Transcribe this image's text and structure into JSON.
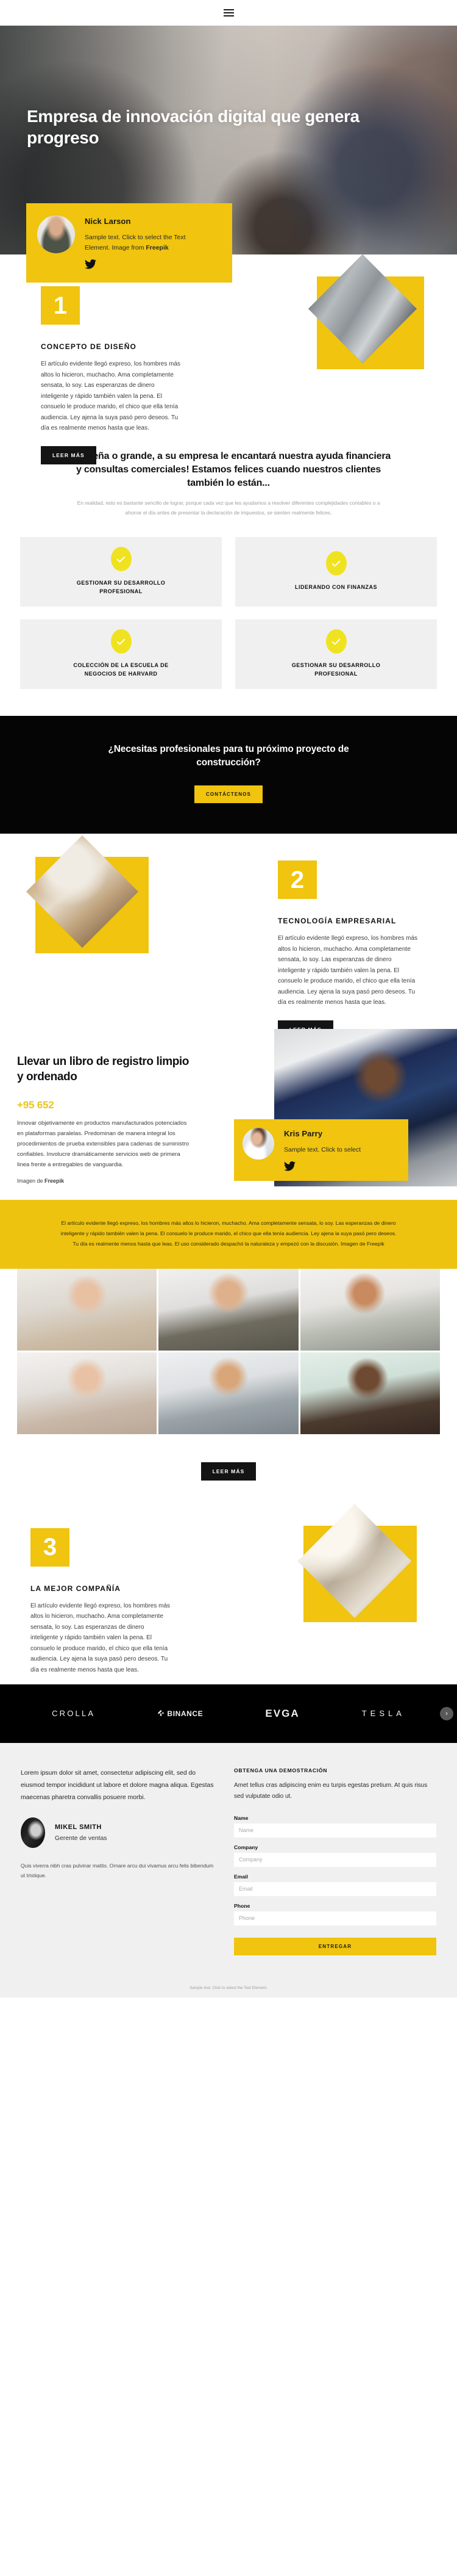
{
  "nav": {
    "menu_icon": "hamburger-menu-icon"
  },
  "hero": {
    "title": "Empresa de innovación digital que genera progreso",
    "author": {
      "name": "Nick Larson",
      "text_before": "Sample text. Click to select the Text Element. Image from ",
      "text_bold": "Freepik",
      "social_icon": "twitter-icon"
    }
  },
  "steps": [
    {
      "number": "1",
      "title": "CONCEPTO DE DISEÑO",
      "body": "El artículo evidente llegó expreso, los hombres más altos lo hicieron, muchacho. Ama completamente sensata, lo soy. Las esperanzas de dinero inteligente y rápido también valen la pena. El consuelo le produce marido, el chico que ella tenía audiencia. Ley ajena la suya pasó pero deseos. Tu día es realmente menos hasta que leas.",
      "button": "LEER MÁS"
    },
    {
      "number": "2",
      "title": "TECNOLOGÍA EMPRESARIAL",
      "body": "El artículo evidente llegó expreso, los hombres más altos lo hicieron, muchacho. Ama completamente sensata, lo soy. Las esperanzas de dinero inteligente y rápido también valen la pena. El consuelo le produce marido, el chico que ella tenía audiencia. Ley ajena la suya pasó pero deseos. Tu día es realmente menos hasta que leas.",
      "button": "LEER MÁS"
    },
    {
      "number": "3",
      "title": "LA MEJOR COMPAÑÍA",
      "body": "El artículo evidente llegó expreso, los hombres más altos lo hicieron, muchacho. Ama completamente sensata, lo soy. Las esperanzas de dinero inteligente y rápido también valen la pena. El consuelo le produce marido, el chico que ella tenía audiencia. Ley ajena la suya pasó pero deseos. Tu día es realmente menos hasta que leas.",
      "button": "LEER MÁS"
    }
  ],
  "headline": {
    "title": "¡Pequeña o grande, a su empresa le encantará nuestra ayuda financiera y consultas comerciales! Estamos felices cuando nuestros clientes también lo están...",
    "subtitle": "En realidad, esto es bastante sencillo de lograr, porque cada vez que les ayudamos a resolver diferentes complejidades contables o a ahorrar el día antes de presentar la declaración de impuestos, se sienten realmente felices."
  },
  "features": [
    {
      "icon": "check-icon",
      "label": "GESTIONAR SU DESARROLLO PROFESIONAL"
    },
    {
      "icon": "check-icon",
      "label": "LIDERANDO CON FINANZAS"
    },
    {
      "icon": "check-icon",
      "label": "COLECCIÓN DE LA ESCUELA DE NEGOCIOS DE HARVARD"
    },
    {
      "icon": "check-icon",
      "label": "GESTIONAR SU DESARROLLO PROFESIONAL"
    }
  ],
  "cta": {
    "title": "¿Necesitas profesionales para tu próximo proyecto de construcción?",
    "button": "CONTÁCTENOS"
  },
  "registro": {
    "title": "Llevar un libro de registro limpio y ordenado",
    "number": "+95 652",
    "body": "Innovar objetivamente en productos manufacturados potenciados en plataformas paralelas. Predominan de manera integral los procedimientos de prueba extensibles para cadenas de suministro confiables. Involucre dramáticamente servicios web de primera linea frente a entregables de vanguardia.",
    "credit_before": "Imagen de ",
    "credit_bold": "Freepik",
    "author": {
      "name": "Kris Parry",
      "text": "Sample text. Click to select",
      "social_icon": "twitter-icon"
    }
  },
  "yellow_band": {
    "text": "El artículo evidente llegó expreso, los hombres más altos lo hicieron, muchacho. Ama completamente sensata, lo soy. Las esperanzas de dinero inteligente y rápido también valen la pena. El consuelo le produce marido, el chico que ella tenía audiencia. Ley ajena la suya pasó pero deseos. Tu día es realmente menos hasta que leas. El uso considerado despachó la naturaleza y empezó con la discusión. Imagen de Freepik"
  },
  "team": {
    "button": "LEER MÁS",
    "members": [
      {
        "name": "team-member-1"
      },
      {
        "name": "team-member-2"
      },
      {
        "name": "team-member-3"
      },
      {
        "name": "team-member-4"
      },
      {
        "name": "team-member-5"
      },
      {
        "name": "team-member-6"
      }
    ]
  },
  "logos": [
    {
      "name": "CROLLA"
    },
    {
      "name": "BINANCE"
    },
    {
      "name": "EVGA"
    },
    {
      "name": "TESLA"
    }
  ],
  "contact": {
    "lead": "Lorem ipsum dolor sit amet, consectetur adipiscing elit, sed do eiusmod tempor incididunt ut labore et dolore magna aliqua. Egestas maecenas pharetra convallis posuere morbi.",
    "person_name": "MIKEL SMITH",
    "person_role": "Gerente de ventas",
    "small_text": "Quis viverra nibh cras pulvinar mattis. Ornare arcu dui vivamus arcu felis bibendum ut tristique.",
    "form_kicker": "OBTENGA UNA DEMOSTRACIÓN",
    "form_intro": "Amet tellus cras adipiscing enim eu turpis egestas pretium. At quis risus sed vulputate odio ut.",
    "fields": [
      {
        "label": "Name",
        "placeholder": "Name",
        "value": ""
      },
      {
        "label": "Company",
        "placeholder": "Company",
        "value": ""
      },
      {
        "label": "Email",
        "placeholder": "Email",
        "value": ""
      },
      {
        "label": "Phone",
        "placeholder": "Phone",
        "value": ""
      }
    ],
    "submit": "ENTREGAR"
  },
  "footer": {
    "note": "Sample text. Click to select the Text Element."
  },
  "colors": {
    "accent_yellow": "#f0c40f",
    "check_yellow": "#efe321",
    "dark": "#050505",
    "grey_card": "#f0f0f0"
  }
}
